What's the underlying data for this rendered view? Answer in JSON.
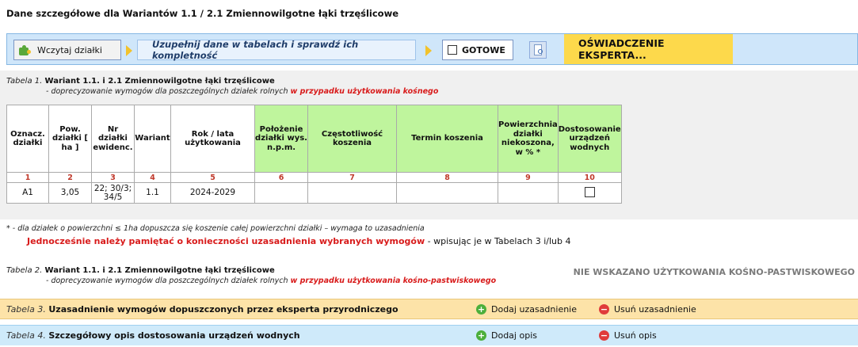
{
  "page_title": "Dane szczegółowe dla Wariantów 1.1 / 2.1  Zmiennowilgotne łąki trzęślicowe",
  "toolbar": {
    "load_label": "Wczytaj działki",
    "step_label": "Uzupełnij dane w tabelach i sprawdź ich kompletność",
    "ready_label": "GOTOWE",
    "ready_checked": false,
    "expert_label": "OŚWIADCZENIE EKSPERTA..."
  },
  "table1": {
    "caption_prefix": "Tabela",
    "caption_num": "1.",
    "caption_title": "Wariant 1.1. i 2.1 Zmiennowilgotne łąki trzęślicowe",
    "sub_text": "- doprecyzowanie wymogów dla poszczególnych działek rolnych",
    "sub_red": "w przypadku użytkowania kośnego",
    "headers": [
      "Oznacz. działki",
      "Pow. działki [ ha ]",
      "Nr działki ewidenc.",
      "Wariant",
      "Rok / lata użytkowania",
      "Położenie działki wys. n.p.m.",
      "Częstotliwość koszenia",
      "Termin koszenia",
      "Powierzchnia działki niekoszona, w % *",
      "Dostosowanie urządzeń wodnych"
    ],
    "col_nums": [
      "1",
      "2",
      "3",
      "4",
      "5",
      "6",
      "7",
      "8",
      "9",
      "10"
    ],
    "row": {
      "oznacz": "A1",
      "pow": "3,05",
      "nr_ewid": "22; 30/3; 34/5",
      "wariant": "1.1",
      "rok": "2024-2029",
      "polozenie": "",
      "czestotliwosc": "",
      "termin": "",
      "niekoszona": "",
      "dostosowanie_checked": false
    }
  },
  "notes": {
    "footnote": "* - dla działek o powierzchni ≤ 1ha dopuszcza się koszenie całej powierzchni działki – wymaga to uzasadnienia",
    "reminder_red": "Jednocześnie należy pamiętać o konieczności uzasadnienia wybranych wymogów",
    "reminder_rest": " - wpisując je w Tabelach 3 i/lub 4"
  },
  "table2": {
    "caption_prefix": "Tabela",
    "caption_num": "2.",
    "caption_title": "Wariant 1.1. i 2.1 Zmiennowilgotne łąki trzęślicowe",
    "sub_text": "- doprecyzowanie wymogów dla poszczególnych działek rolnych",
    "sub_red": "w przypadku użytkowania kośno-pastwiskowego",
    "empty_notice": "NIE WSKAZANO UŻYTKOWANIA KOŚNO-PASTWISKOWEGO"
  },
  "table3": {
    "caption_prefix": "Tabela",
    "caption_num": "3.",
    "caption_title": "Uzasadnienie wymogów dopuszczonych przez eksperta przyrodniczego",
    "add_label": "Dodaj uzasadnienie",
    "remove_label": "Usuń uzasadnienie"
  },
  "table4": {
    "caption_prefix": "Tabela",
    "caption_num": "4.",
    "caption_title": "Szczegółowy opis dostosowania urządzeń wodnych",
    "add_label": "Dodaj opis",
    "remove_label": "Usuń opis"
  },
  "colors": {
    "toolbar_bg": "#cfe6fa",
    "expert_bg": "#fdd94b",
    "green_header": "#bff59d",
    "accent_red": "#d81b1b",
    "table3_bg": "#fde3a8",
    "table4_bg": "#cfeafa"
  },
  "icons": {
    "load": "puzzle-icon",
    "step_arrow": "arrow-right-icon",
    "preview": "document-preview-icon",
    "add": "plus-circle-icon",
    "remove": "minus-circle-icon"
  }
}
